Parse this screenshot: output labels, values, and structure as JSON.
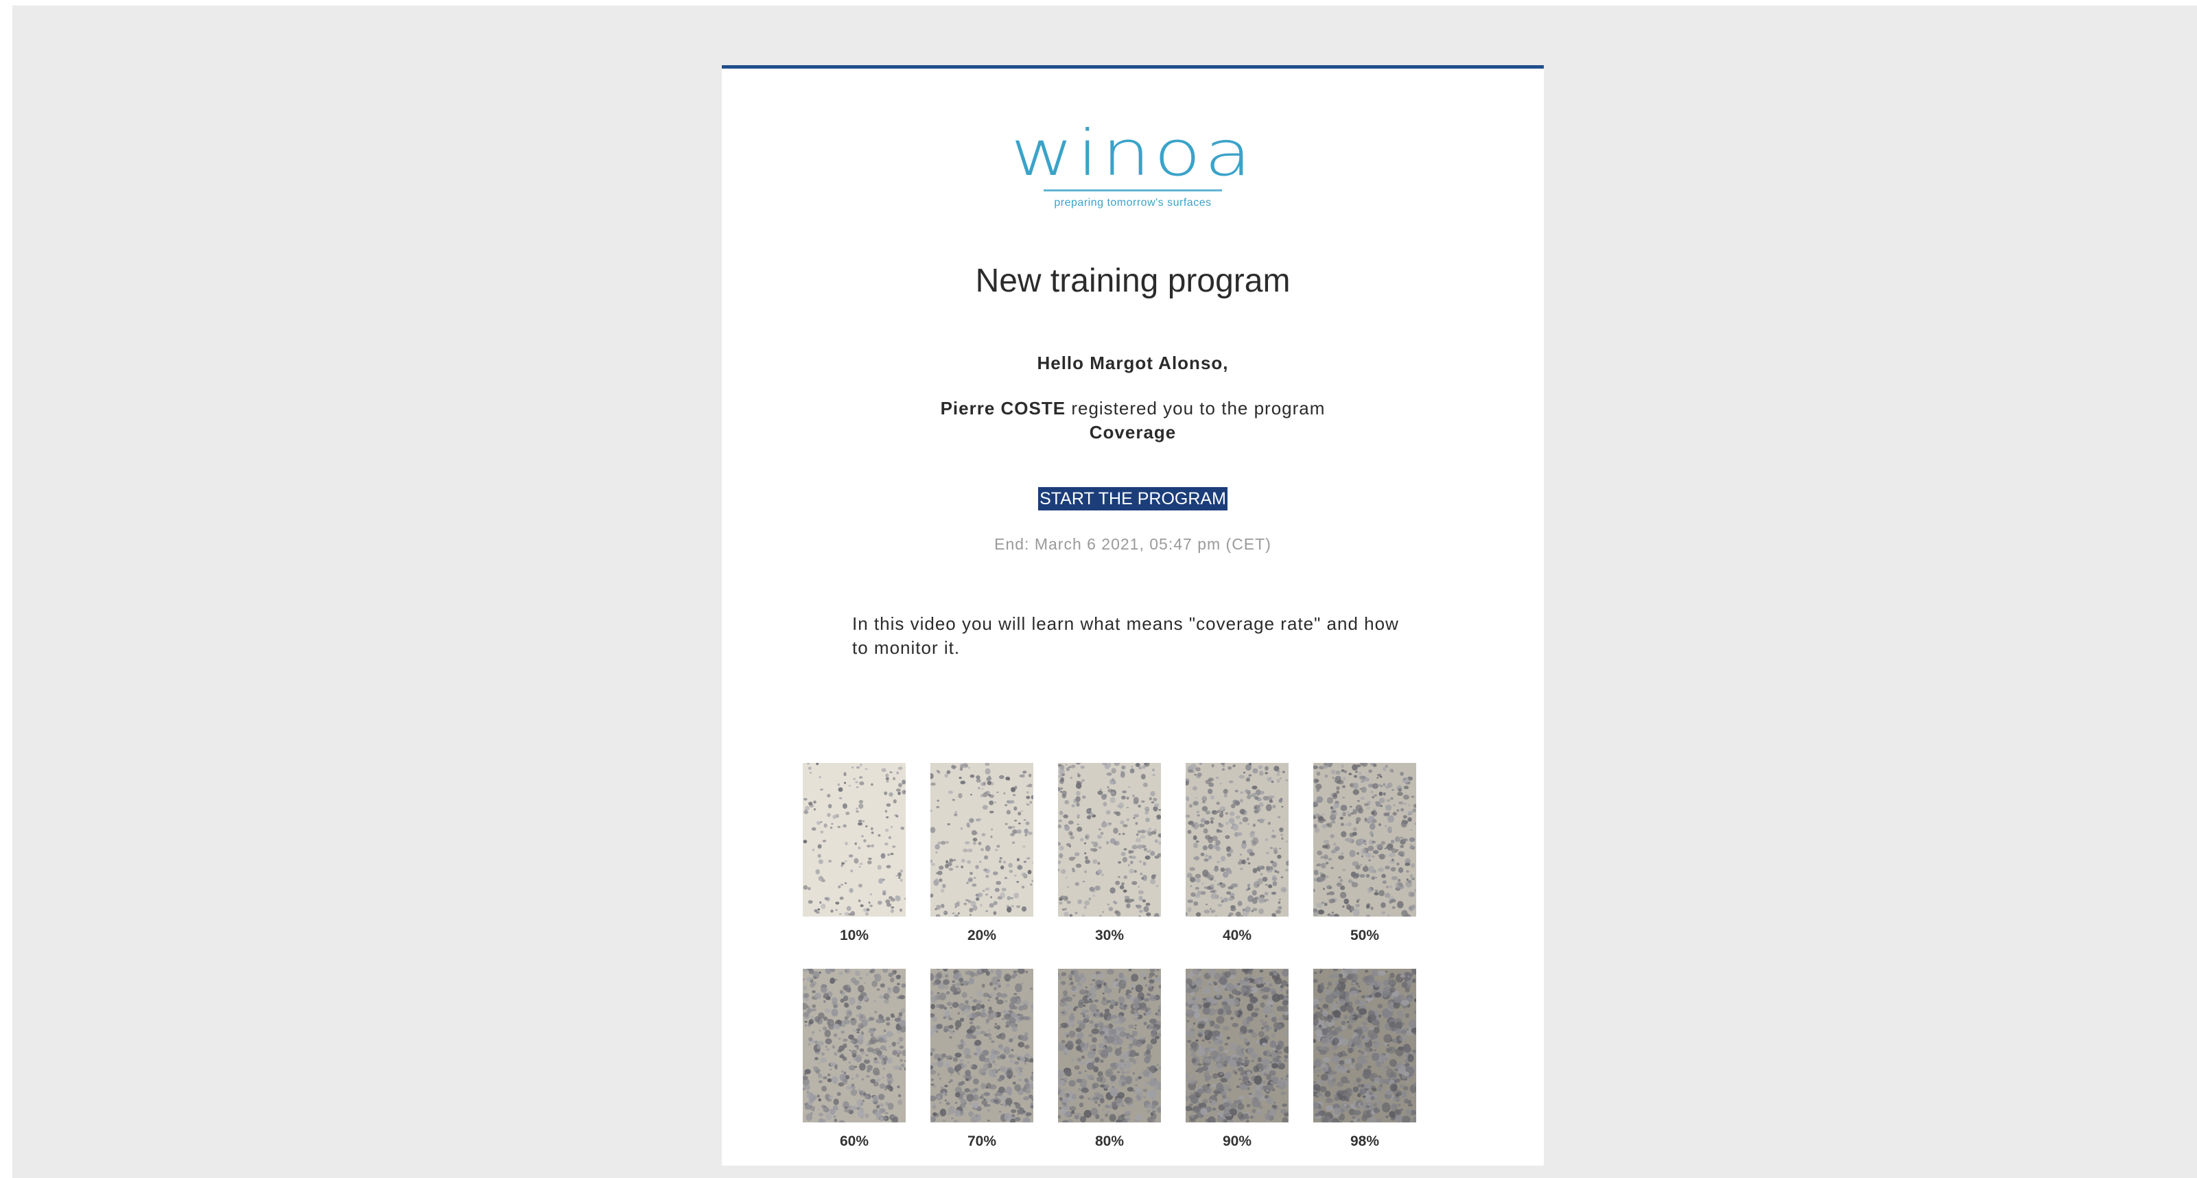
{
  "brand": {
    "logo_text": "winoa",
    "tagline": "preparing tomorrow's surfaces"
  },
  "email": {
    "title": "New training program",
    "greeting": "Hello Margot Alonso,",
    "registrar": "Pierre COSTE",
    "registered_text": "registered you to the program",
    "program_name": "Coverage",
    "cta_label": "START THE PROGRAM",
    "end_date": "End: March 6 2021, 05:47 pm (CET)",
    "description": "In this video you will learn what means \"coverage rate\" and how to monitor it."
  },
  "samples": [
    {
      "label": "10%",
      "coverage": 0.1
    },
    {
      "label": "20%",
      "coverage": 0.2
    },
    {
      "label": "30%",
      "coverage": 0.3
    },
    {
      "label": "40%",
      "coverage": 0.4
    },
    {
      "label": "50%",
      "coverage": 0.5
    },
    {
      "label": "60%",
      "coverage": 0.6
    },
    {
      "label": "70%",
      "coverage": 0.7
    },
    {
      "label": "80%",
      "coverage": 0.8
    },
    {
      "label": "90%",
      "coverage": 0.9
    },
    {
      "label": "98%",
      "coverage": 0.98
    }
  ],
  "colors": {
    "accent": "#1f4e8c",
    "logo": "#3aa3c9",
    "cta_bg": "#1b3d7a",
    "backdrop": "#ebebeb"
  }
}
